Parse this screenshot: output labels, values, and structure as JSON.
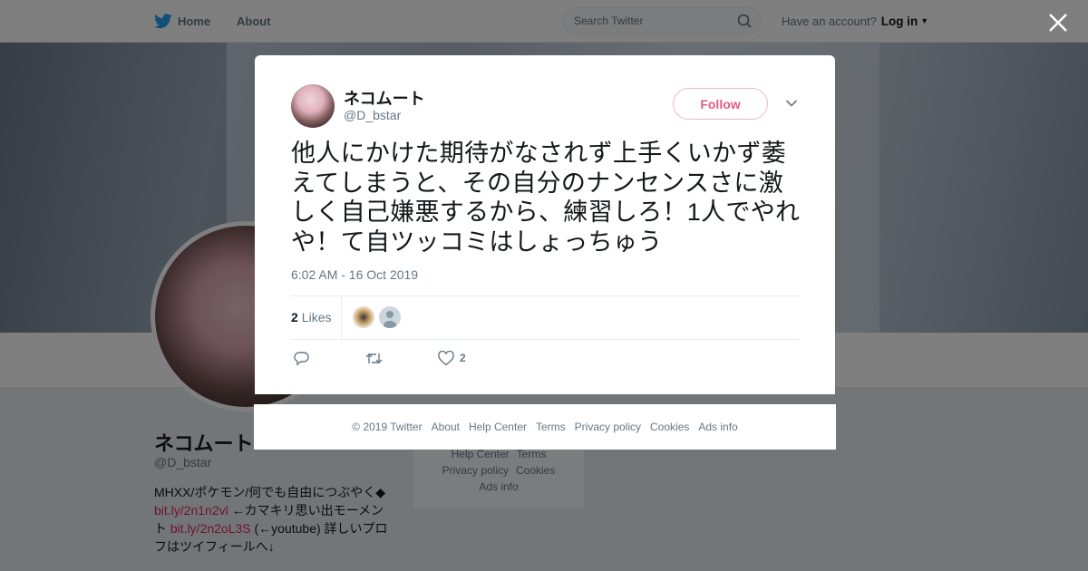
{
  "header": {
    "home_label": "Home",
    "about_label": "About",
    "search_placeholder": "Search Twitter",
    "have_account_text": "Have an account?",
    "login_label": "Log in"
  },
  "profile": {
    "name": "ネコムート",
    "handle": "@D_bstar",
    "bio_line1": "MHXX/ポケモン/何でも自由につぶやく◆",
    "bio_link1": "bit.ly/2n1n2vl",
    "bio_line2": " ←カマキリ思い出モーメント ",
    "bio_link2": "bit.ly/2n2oL3S",
    "bio_line3": " (←youtube) 詳しいプロフはツイフィールへ↓"
  },
  "sidebar_footer": {
    "links": [
      "Help Center",
      "Terms",
      "Privacy policy",
      "Cookies",
      "Ads info"
    ]
  },
  "tweet": {
    "author_name": "ネコムート",
    "author_handle": "@D_bstar",
    "follow_label": "Follow",
    "text": "他人にかけた期待がなされず上手くいかず萎えてしまうと、その自分のナンセンスさに激しく自己嫌悪するから、練習しろ！1人でやれや！て自ツッコミはしょっちゅう",
    "timestamp": "6:02 AM - 16 Oct 2019",
    "likes_count": "2",
    "likes_label": "Likes",
    "like_action_count": "2"
  },
  "modal_footer": {
    "copyright": "© 2019 Twitter",
    "links": [
      "About",
      "Help Center",
      "Terms",
      "Privacy policy",
      "Cookies",
      "Ads info"
    ]
  },
  "colors": {
    "brand_blue": "#1da1f2",
    "like_pink": "#e0245e",
    "text_gray": "#657786"
  },
  "icons": [
    "twitter-bird-icon",
    "search-icon",
    "close-icon",
    "chevron-down-icon",
    "reply-icon",
    "retweet-icon",
    "heart-icon"
  ]
}
